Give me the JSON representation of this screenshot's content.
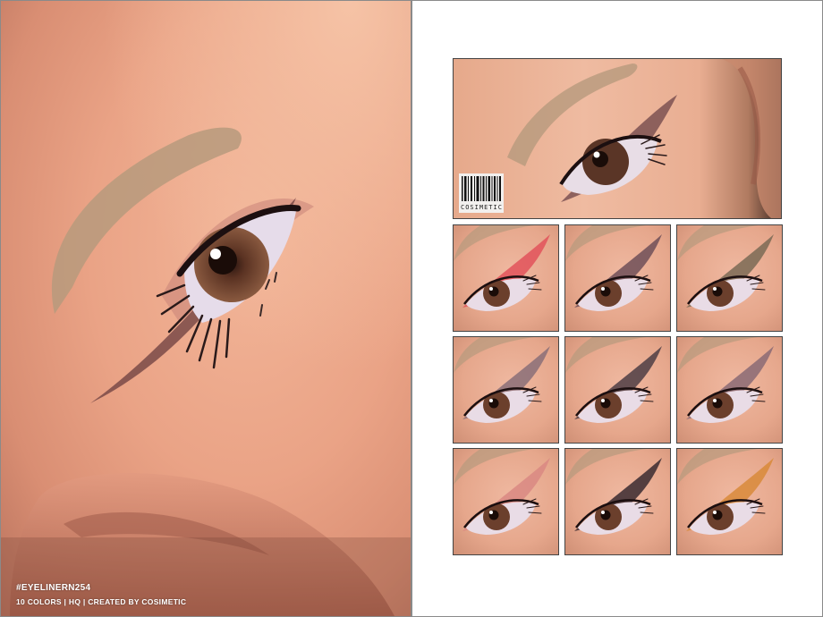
{
  "hero": {
    "title": "#EYELINERN254",
    "subtitle": "10 COLORS | HQ | CREATED BY COSIMETIC"
  },
  "preview": {
    "barcode_label": "COSIMETIC"
  },
  "swatches": [
    {
      "liner_color": "#e2525a"
    },
    {
      "liner_color": "#6e4f58"
    },
    {
      "liner_color": "#7a6a55"
    },
    {
      "liner_color": "#8a6e78"
    },
    {
      "liner_color": "#4d3d44"
    },
    {
      "liner_color": "#8a6a74"
    },
    {
      "liner_color": "#d98882"
    },
    {
      "liner_color": "#3a2a30"
    },
    {
      "liner_color": "#d88a3a"
    }
  ],
  "colors": {
    "frame": "#8a8a8a",
    "skin": "#eaa386",
    "brow": "#b79a7d",
    "iris": "#6b3f2c"
  }
}
